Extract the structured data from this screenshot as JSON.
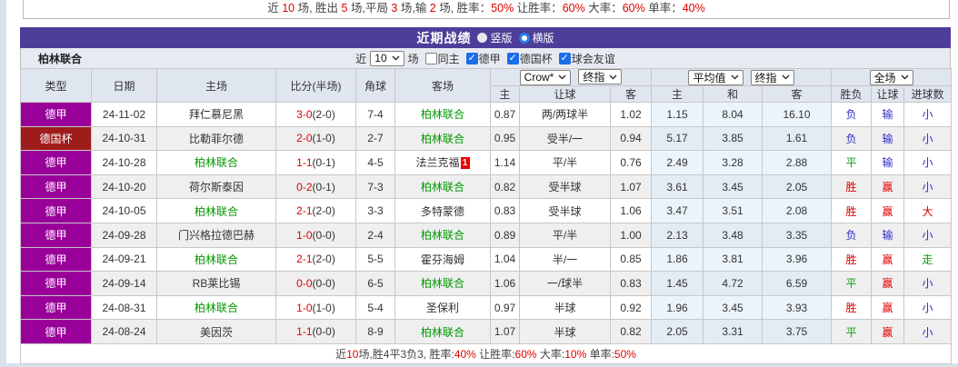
{
  "page": {
    "top_summary_segments": [
      {
        "t": "近 ",
        "red": false
      },
      {
        "t": "10",
        "red": true
      },
      {
        "t": " 场, 胜出 ",
        "red": false
      },
      {
        "t": "5",
        "red": true
      },
      {
        "t": " 场,平局 ",
        "red": false
      },
      {
        "t": "3",
        "red": true
      },
      {
        "t": " 场,输 ",
        "red": false
      },
      {
        "t": "2",
        "red": true
      },
      {
        "t": " 场, 胜率：",
        "red": false
      },
      {
        "t": "50%",
        "red": true
      },
      {
        "t": " 让胜率：",
        "red": false
      },
      {
        "t": "60%",
        "red": true
      },
      {
        "t": " 大率：",
        "red": false
      },
      {
        "t": "60%",
        "red": true
      },
      {
        "t": " 单率：",
        "red": false
      },
      {
        "t": "40%",
        "red": true
      }
    ],
    "bottom_summary_segments": [
      {
        "t": "近",
        "red": false
      },
      {
        "t": "10",
        "red": true
      },
      {
        "t": "场,胜4平3负3, 胜率:",
        "red": false
      },
      {
        "t": "40%",
        "red": true
      },
      {
        "t": " 让胜率:",
        "red": false
      },
      {
        "t": "60%",
        "red": true
      },
      {
        "t": " 大率:",
        "red": false
      },
      {
        "t": "10%",
        "red": true
      },
      {
        "t": " 单率:",
        "red": false
      },
      {
        "t": "50%",
        "red": true
      }
    ]
  },
  "header": {
    "title": "近期战绩",
    "view_options": [
      {
        "label": "竖版",
        "selected": false
      },
      {
        "label": "横版",
        "selected": true
      }
    ]
  },
  "filter": {
    "team": "柏林联合",
    "recent_label": "近",
    "match_count": "10",
    "matches_label": "场",
    "checkboxes": [
      {
        "label": "同主",
        "checked": false
      },
      {
        "label": "德甲",
        "checked": true
      },
      {
        "label": "德国杯",
        "checked": true
      },
      {
        "label": "球会友谊",
        "checked": true
      }
    ]
  },
  "table": {
    "left_headers": [
      "类型",
      "日期",
      "主场",
      "比分(半场)",
      "角球",
      "客场"
    ],
    "selects": {
      "group1": [
        "Crow*",
        "终指"
      ],
      "group2": [
        "平均值",
        "终指"
      ],
      "group3": [
        "全场"
      ]
    },
    "sub_headers": [
      "主",
      "让球",
      "客",
      "主",
      "和",
      "客",
      "胜负",
      "让球",
      "进球数"
    ],
    "highlight_team": "柏林联合",
    "rows": [
      {
        "league": "德甲",
        "league_color": "purple",
        "date": "24-11-02",
        "home": "拜仁慕尼黑",
        "home_is_team": false,
        "home_red_card": "",
        "score_ft": "3-0",
        "score_ht": "(2-0)",
        "corners": "7-4",
        "away": "柏林联合",
        "away_is_team": true,
        "away_red_card": "",
        "crown_home": "0.87",
        "handicap": "两/两球半",
        "crown_away": "1.02",
        "avg_home": "1.15",
        "avg_draw": "8.04",
        "avg_away": "16.10",
        "result_wdl": "负",
        "result_wdl_color": "blue",
        "result_handicap": "输",
        "result_handicap_color": "blue",
        "result_goals": "小",
        "result_goals_color": "blue"
      },
      {
        "league": "德国杯",
        "league_color": "red",
        "date": "24-10-31",
        "home": "比勒菲尔德",
        "home_is_team": false,
        "home_red_card": "",
        "score_ft": "2-0",
        "score_ht": "(1-0)",
        "corners": "2-7",
        "away": "柏林联合",
        "away_is_team": true,
        "away_red_card": "",
        "crown_home": "0.95",
        "handicap": "受半/一",
        "crown_away": "0.94",
        "avg_home": "5.17",
        "avg_draw": "3.85",
        "avg_away": "1.61",
        "result_wdl": "负",
        "result_wdl_color": "blue",
        "result_handicap": "输",
        "result_handicap_color": "blue",
        "result_goals": "小",
        "result_goals_color": "blue"
      },
      {
        "league": "德甲",
        "league_color": "purple",
        "date": "24-10-28",
        "home": "柏林联合",
        "home_is_team": true,
        "home_red_card": "",
        "score_ft": "1-1",
        "score_ht": "(0-1)",
        "corners": "4-5",
        "away": "法兰克福",
        "away_is_team": false,
        "away_red_card": "1",
        "crown_home": "1.14",
        "handicap": "平/半",
        "crown_away": "0.76",
        "avg_home": "2.49",
        "avg_draw": "3.28",
        "avg_away": "2.88",
        "result_wdl": "平",
        "result_wdl_color": "green",
        "result_handicap": "输",
        "result_handicap_color": "blue",
        "result_goals": "小",
        "result_goals_color": "blue"
      },
      {
        "league": "德甲",
        "league_color": "purple",
        "date": "24-10-20",
        "home": "荷尔斯泰因",
        "home_is_team": false,
        "home_red_card": "",
        "score_ft": "0-2",
        "score_ht": "(0-1)",
        "corners": "7-3",
        "away": "柏林联合",
        "away_is_team": true,
        "away_red_card": "",
        "crown_home": "0.82",
        "handicap": "受半球",
        "crown_away": "1.07",
        "avg_home": "3.61",
        "avg_draw": "3.45",
        "avg_away": "2.05",
        "result_wdl": "胜",
        "result_wdl_color": "red",
        "result_handicap": "赢",
        "result_handicap_color": "red",
        "result_goals": "小",
        "result_goals_color": "blue"
      },
      {
        "league": "德甲",
        "league_color": "purple",
        "date": "24-10-05",
        "home": "柏林联合",
        "home_is_team": true,
        "home_red_card": "",
        "score_ft": "2-1",
        "score_ht": "(2-0)",
        "corners": "3-3",
        "away": "多特蒙德",
        "away_is_team": false,
        "away_red_card": "",
        "crown_home": "0.83",
        "handicap": "受半球",
        "crown_away": "1.06",
        "avg_home": "3.47",
        "avg_draw": "3.51",
        "avg_away": "2.08",
        "result_wdl": "胜",
        "result_wdl_color": "red",
        "result_handicap": "赢",
        "result_handicap_color": "red",
        "result_goals": "大",
        "result_goals_color": "red"
      },
      {
        "league": "德甲",
        "league_color": "purple",
        "date": "24-09-28",
        "home": "门兴格拉德巴赫",
        "home_is_team": false,
        "home_red_card": "",
        "score_ft": "1-0",
        "score_ht": "(0-0)",
        "corners": "2-4",
        "away": "柏林联合",
        "away_is_team": true,
        "away_red_card": "",
        "crown_home": "0.89",
        "handicap": "平/半",
        "crown_away": "1.00",
        "avg_home": "2.13",
        "avg_draw": "3.48",
        "avg_away": "3.35",
        "result_wdl": "负",
        "result_wdl_color": "blue",
        "result_handicap": "输",
        "result_handicap_color": "blue",
        "result_goals": "小",
        "result_goals_color": "blue"
      },
      {
        "league": "德甲",
        "league_color": "purple",
        "date": "24-09-21",
        "home": "柏林联合",
        "home_is_team": true,
        "home_red_card": "",
        "score_ft": "2-1",
        "score_ht": "(2-0)",
        "corners": "5-5",
        "away": "霍芬海姆",
        "away_is_team": false,
        "away_red_card": "",
        "crown_home": "1.04",
        "handicap": "半/一",
        "crown_away": "0.85",
        "avg_home": "1.86",
        "avg_draw": "3.81",
        "avg_away": "3.96",
        "result_wdl": "胜",
        "result_wdl_color": "red",
        "result_handicap": "赢",
        "result_handicap_color": "red",
        "result_goals": "走",
        "result_goals_color": "green"
      },
      {
        "league": "德甲",
        "league_color": "purple",
        "date": "24-09-14",
        "home": "RB莱比锡",
        "home_is_team": false,
        "home_red_card": "",
        "score_ft": "0-0",
        "score_ht": "(0-0)",
        "corners": "6-5",
        "away": "柏林联合",
        "away_is_team": true,
        "away_red_card": "",
        "crown_home": "1.06",
        "handicap": "一/球半",
        "crown_away": "0.83",
        "avg_home": "1.45",
        "avg_draw": "4.72",
        "avg_away": "6.59",
        "result_wdl": "平",
        "result_wdl_color": "green",
        "result_handicap": "赢",
        "result_handicap_color": "red",
        "result_goals": "小",
        "result_goals_color": "blue"
      },
      {
        "league": "德甲",
        "league_color": "purple",
        "date": "24-08-31",
        "home": "柏林联合",
        "home_is_team": true,
        "home_red_card": "",
        "score_ft": "1-0",
        "score_ht": "(1-0)",
        "corners": "5-4",
        "away": "圣保利",
        "away_is_team": false,
        "away_red_card": "",
        "crown_home": "0.97",
        "handicap": "半球",
        "crown_away": "0.92",
        "avg_home": "1.96",
        "avg_draw": "3.45",
        "avg_away": "3.93",
        "result_wdl": "胜",
        "result_wdl_color": "red",
        "result_handicap": "赢",
        "result_handicap_color": "red",
        "result_goals": "小",
        "result_goals_color": "blue"
      },
      {
        "league": "德甲",
        "league_color": "purple",
        "date": "24-08-24",
        "home": "美因茨",
        "home_is_team": false,
        "home_red_card": "",
        "score_ft": "1-1",
        "score_ht": "(0-0)",
        "corners": "8-9",
        "away": "柏林联合",
        "away_is_team": true,
        "away_red_card": "",
        "crown_home": "1.07",
        "handicap": "半球",
        "crown_away": "0.82",
        "avg_home": "2.05",
        "avg_draw": "3.31",
        "avg_away": "3.75",
        "result_wdl": "平",
        "result_wdl_color": "green",
        "result_handicap": "赢",
        "result_handicap_color": "red",
        "result_goals": "小",
        "result_goals_color": "blue"
      }
    ]
  },
  "colors": {
    "accent_purple": "#4c3e99",
    "bundesliga_badge": "#990099",
    "dfb_pokal_badge": "#9e1c1c",
    "win_red": "#e00000",
    "lose_blue": "#2d2dc8",
    "draw_green": "#11a011",
    "team_green": "#009900",
    "checkbox_blue": "#1b6ee8"
  }
}
